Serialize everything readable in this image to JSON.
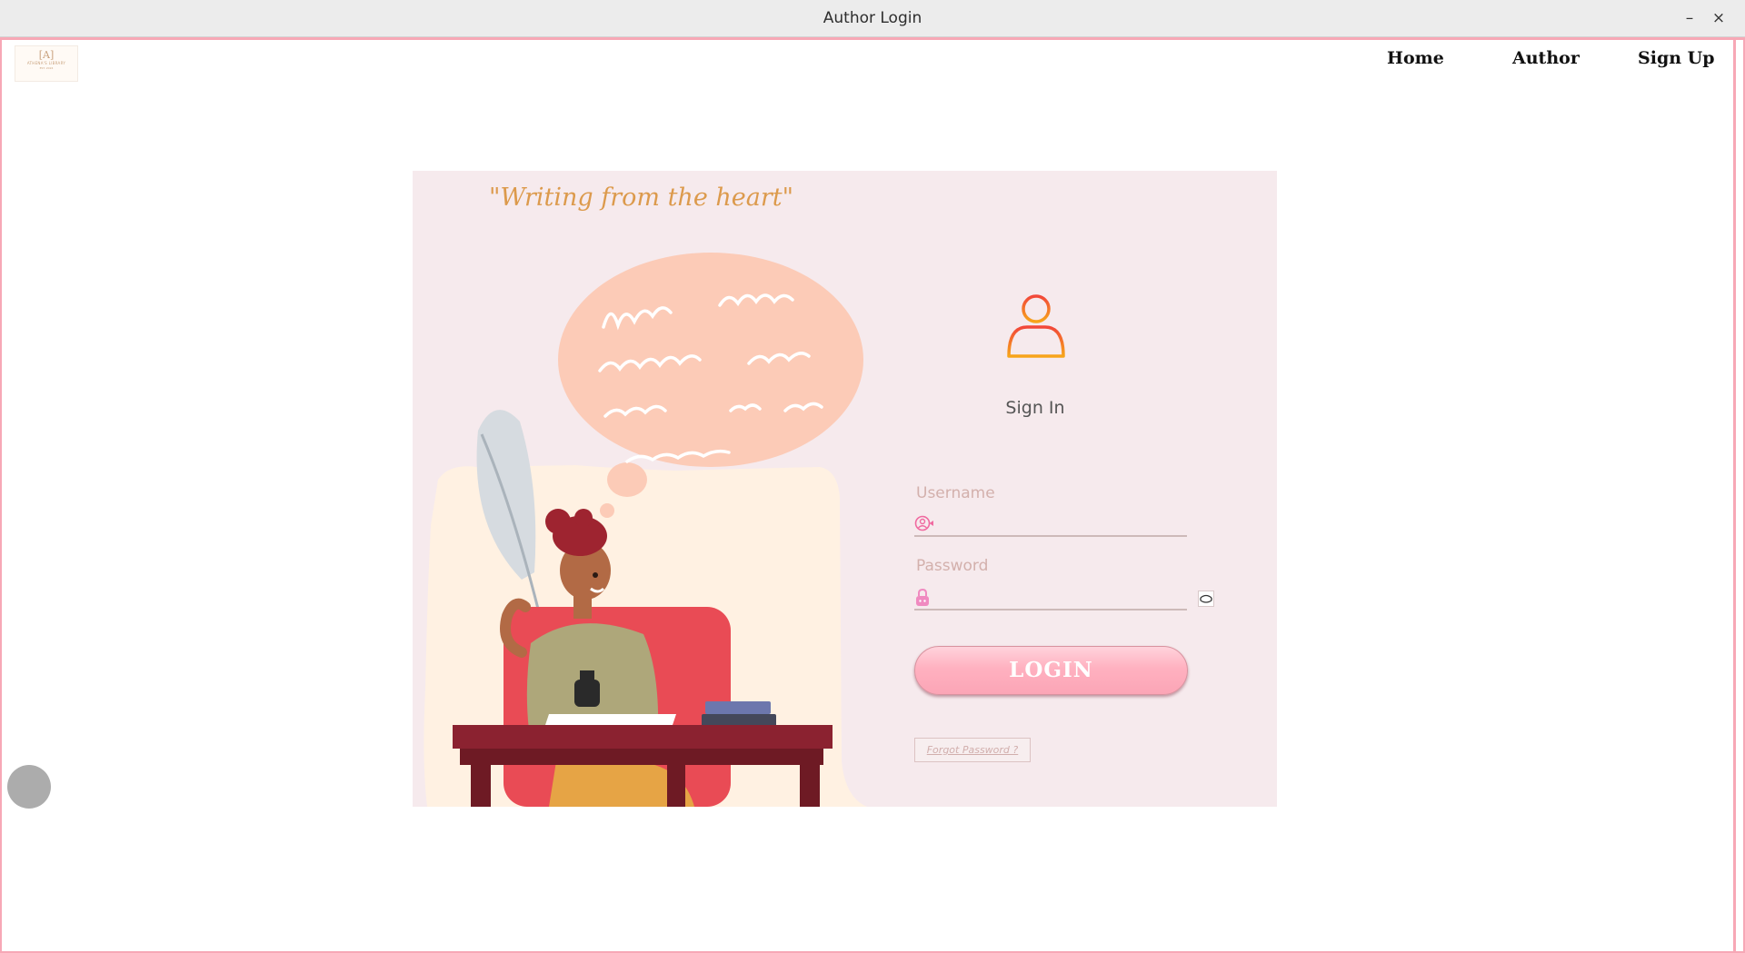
{
  "window": {
    "title": "Author Login",
    "minimize_glyph": "–",
    "close_glyph": "×"
  },
  "header": {
    "logo": {
      "mark": "[A]",
      "name": "ATHENA'S LIBRARY",
      "sub": "EST. 2024"
    },
    "nav": [
      {
        "label": "Home"
      },
      {
        "label": "Author"
      },
      {
        "label": "Sign Up"
      }
    ]
  },
  "card": {
    "quote": "\"Writing from the heart\"",
    "signin_label": "Sign In",
    "username": {
      "label": "Username",
      "value": "",
      "icon": "user-circle-icon"
    },
    "password": {
      "label": "Password",
      "value": "",
      "icon": "lock-icon",
      "toggle_icon": "eye-toggle-icon"
    },
    "login_label": "LOGIN",
    "forgot_label": "Forgot Password ?"
  },
  "colors": {
    "card_bg": "#f6eaed",
    "accent_pink": "#fba5b6",
    "quote_color": "#dc9a4c",
    "frame_pink": "#f7a8b6"
  }
}
